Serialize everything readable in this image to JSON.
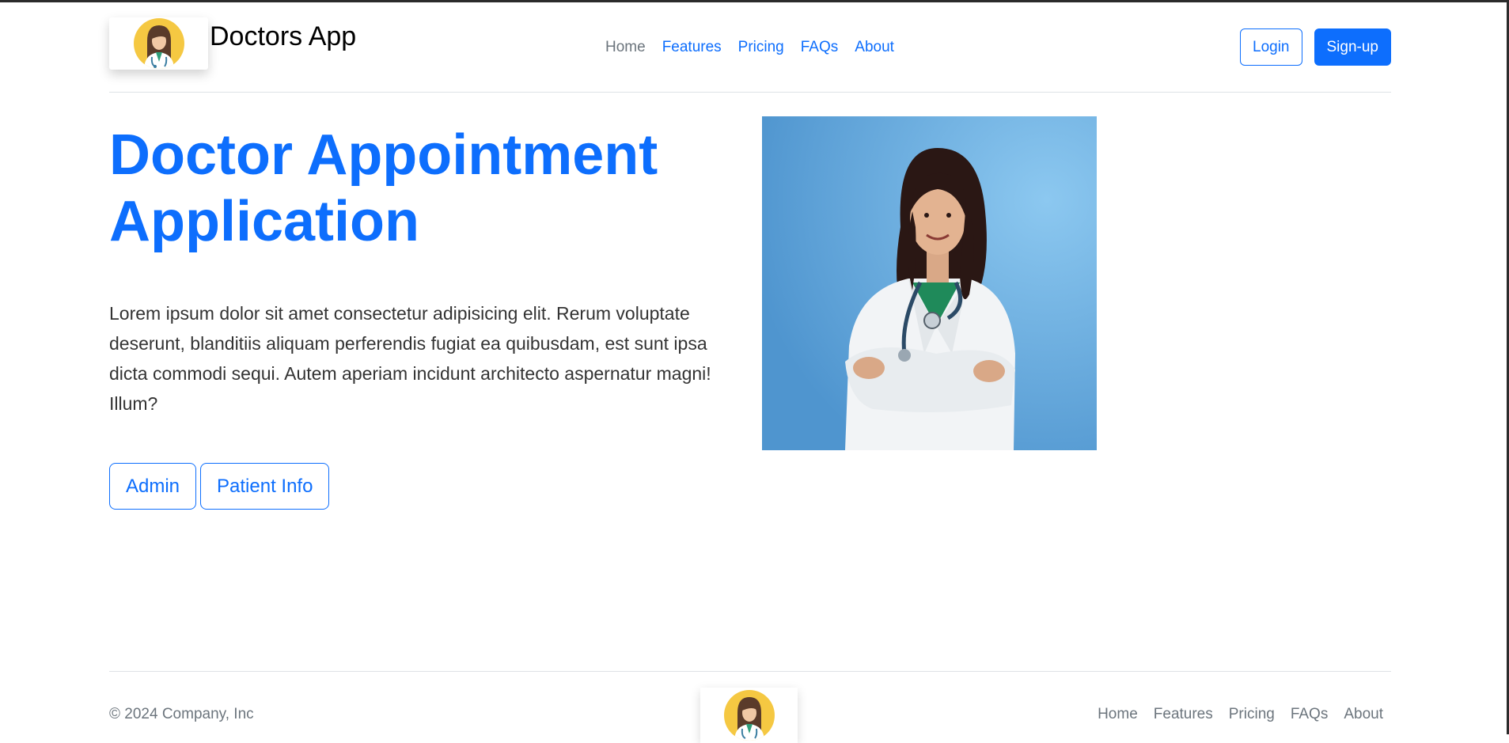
{
  "header": {
    "brand_name": "Doctors App",
    "nav": {
      "home": "Home",
      "features": "Features",
      "pricing": "Pricing",
      "faqs": "FAQs",
      "about": "About"
    },
    "login_label": "Login",
    "signup_label": "Sign-up"
  },
  "hero": {
    "title_line1": "Doctor Appointment",
    "title_line2": "Application",
    "body": "Lorem ipsum dolor sit amet consectetur adipisicing elit. Rerum voluptate deserunt, blanditiis aliquam perferendis fugiat ea quibusdam, est sunt ipsa dicta commodi sequi. Autem aperiam incidunt architecto aspernatur magni! Illum?",
    "admin_button": "Admin",
    "patient_info_button": "Patient Info"
  },
  "footer": {
    "copyright": "© 2024 Company, Inc",
    "nav": {
      "home": "Home",
      "features": "Features",
      "pricing": "Pricing",
      "faqs": "FAQs",
      "about": "About"
    }
  },
  "colors": {
    "primary": "#0d6efd",
    "muted": "#6c757d",
    "logo_background": "#f5c842",
    "photo_background": "#6aaee0"
  },
  "icons": {
    "logo": "doctor-avatar-icon",
    "hero_image": "doctor-photo"
  }
}
